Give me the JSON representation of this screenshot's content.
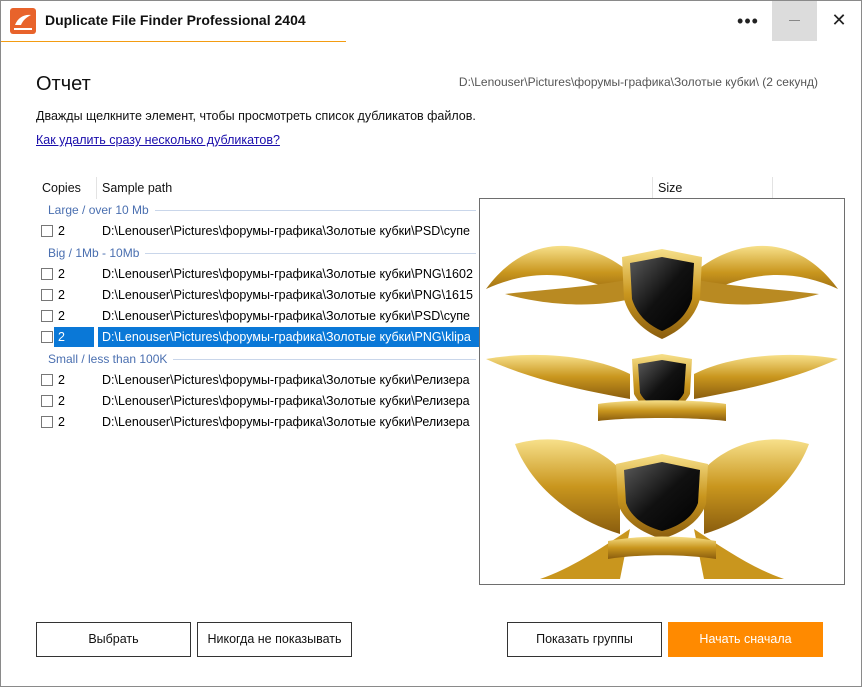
{
  "window": {
    "title": "Duplicate File Finder Professional 2404"
  },
  "header": {
    "title": "Отчет",
    "scan_path": "D:\\Lenouser\\Pictures\\форумы-графика\\Золотые кубки\\ (2 секунд)",
    "instructions": "Дважды щелкните элемент, чтобы просмотреть список дубликатов файлов.",
    "help_link": "Как удалить сразу несколько дубликатов?"
  },
  "table": {
    "columns": {
      "copies": "Copies",
      "sample_path": "Sample path",
      "size": "Size"
    },
    "groups": [
      {
        "label": "Large / over 10 Mb",
        "rows": [
          {
            "copies": "2",
            "path": "D:\\Lenouser\\Pictures\\форумы-графика\\Золотые кубки\\PSD\\супе",
            "selected": false
          }
        ]
      },
      {
        "label": "Big / 1Mb - 10Mb",
        "rows": [
          {
            "copies": "2",
            "path": "D:\\Lenouser\\Pictures\\форумы-графика\\Золотые кубки\\PNG\\1602",
            "selected": false
          },
          {
            "copies": "2",
            "path": "D:\\Lenouser\\Pictures\\форумы-графика\\Золотые кубки\\PNG\\1615",
            "selected": false
          },
          {
            "copies": "2",
            "path": "D:\\Lenouser\\Pictures\\форумы-графика\\Золотые кубки\\PSD\\супе",
            "selected": false
          },
          {
            "copies": "2",
            "path": "D:\\Lenouser\\Pictures\\форумы-графика\\Золотые кубки\\PNG\\klipa",
            "selected": true
          }
        ]
      },
      {
        "label": "Small / less than 100K",
        "rows": [
          {
            "copies": "2",
            "path": "D:\\Lenouser\\Pictures\\форумы-графика\\Золотые кубки\\Релизера",
            "selected": false
          },
          {
            "copies": "2",
            "path": "D:\\Lenouser\\Pictures\\форумы-графика\\Золотые кубки\\Релизера",
            "selected": false
          },
          {
            "copies": "2",
            "path": "D:\\Lenouser\\Pictures\\форумы-графика\\Золотые кубки\\Релизера",
            "selected": false
          }
        ]
      }
    ]
  },
  "buttons": {
    "select": "Выбрать",
    "never_show": "Никогда не показывать",
    "show_groups": "Показать группы",
    "start_over": "Начать сначала"
  },
  "colors": {
    "accent": "#ff8a00",
    "selection": "#0a78d7",
    "group_label": "#4a6fb0",
    "link": "#1a0dab",
    "gold": "#d4a628",
    "shield": "#111111"
  },
  "icons": {
    "logo": "app-logo-icon",
    "more": "more-icon",
    "minimize": "minimize-icon",
    "close": "close-icon"
  }
}
